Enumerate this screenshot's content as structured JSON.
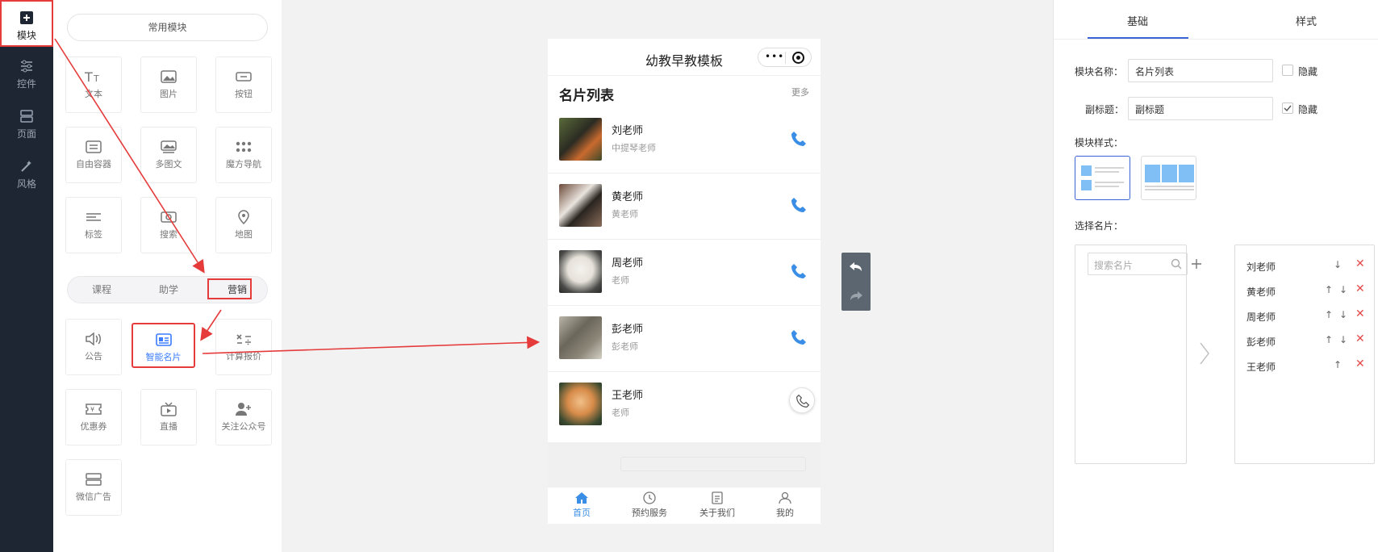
{
  "nav": {
    "items": [
      {
        "label": "模块",
        "icon": "plus-square-icon"
      },
      {
        "label": "控件",
        "icon": "sliders-icon"
      },
      {
        "label": "页面",
        "icon": "layout-icon"
      },
      {
        "label": "风格",
        "icon": "magic-wand-icon"
      }
    ]
  },
  "modules": {
    "common_tab": "常用模块",
    "common": [
      "文本",
      "图片",
      "按钮",
      "自由容器",
      "多图文",
      "魔方导航",
      "标签",
      "搜索",
      "地图"
    ],
    "segments": [
      "课程",
      "助学",
      "营销"
    ],
    "marketing": [
      "公告",
      "智能名片",
      "计算报价",
      "优惠券",
      "直播",
      "关注公众号",
      "微信广告"
    ]
  },
  "phone": {
    "title": "幼教早教模板",
    "section_title": "名片列表",
    "more": "更多",
    "cards": [
      {
        "name": "刘老师",
        "subtitle": "中提琴老师"
      },
      {
        "name": "黄老师",
        "subtitle": "黄老师"
      },
      {
        "name": "周老师",
        "subtitle": "老师"
      },
      {
        "name": "彭老师",
        "subtitle": "彭老师"
      },
      {
        "name": "王老师",
        "subtitle": "老师"
      }
    ],
    "tabs": [
      "首页",
      "预约服务",
      "关于我们",
      "我的"
    ]
  },
  "props": {
    "tabs": [
      "基础",
      "样式"
    ],
    "name_label": "模块名称：",
    "name_value": "名片列表",
    "subtitle_label": "副标题：",
    "subtitle_value": "副标题",
    "hide_label": "隐藏",
    "style_label": "模块样式：",
    "select_label": "选择名片：",
    "search_placeholder": "搜索名片",
    "selected": [
      "刘老师",
      "黄老师",
      "周老师",
      "彭老师",
      "王老师"
    ]
  },
  "colors": {
    "accent": "#3a63d6",
    "highlight": "#e63b3b",
    "phone_blue": "#3a8ee6"
  }
}
